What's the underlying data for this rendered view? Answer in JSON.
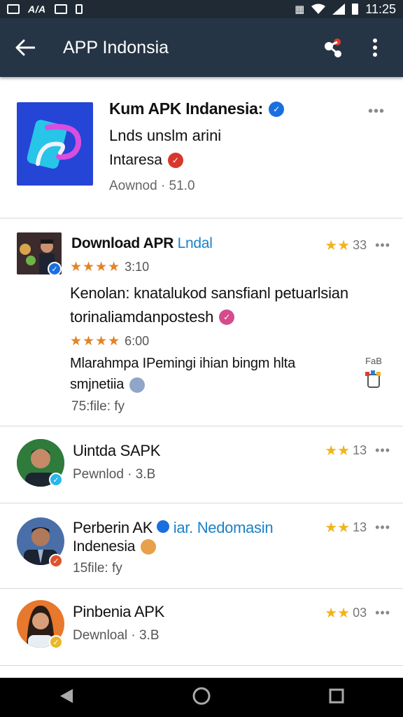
{
  "status_bar": {
    "left_text": "A/⁄A",
    "left_text2": "A/A",
    "time": "11:25"
  },
  "app_bar": {
    "title": "APP Indonsia"
  },
  "hero": {
    "title": "Kum APK Indanesia:",
    "subtitle": "Lnds unslm arini",
    "subtitle2": "Intaresa",
    "meta": "Aownod · 51.0"
  },
  "items": [
    {
      "title": "Download APR",
      "title_accent": "Lndal",
      "rating_count": "33",
      "stars1_value": "3:10",
      "text1": "Kenolan: knatalukod sansfianl petuarlsian",
      "text2": "torinaliamdanpostesh",
      "stars2_value": "6:00",
      "text3": "Mlarahmpa IPemingi ihian bingm hlta",
      "text4": "smjnetiia",
      "meta": "75:file: fy",
      "side_label": "FaB"
    },
    {
      "title": "Uintda SAPK",
      "rating_count": "13",
      "meta": "Pewnlod · 3.B"
    },
    {
      "title": "Perberin AK",
      "title_accent": "iar. Nedomasin",
      "rating_count": "13",
      "subtitle": "Indenesia",
      "meta": "15file: fy"
    },
    {
      "title": "Pinbenia APK",
      "rating_count": "03",
      "meta": "Dewnloal · 3.B"
    }
  ],
  "colors": {
    "app_bar": "#263545",
    "status_bar": "#1f2a35",
    "accent": "#1a82c8",
    "star": "#e2842a"
  }
}
